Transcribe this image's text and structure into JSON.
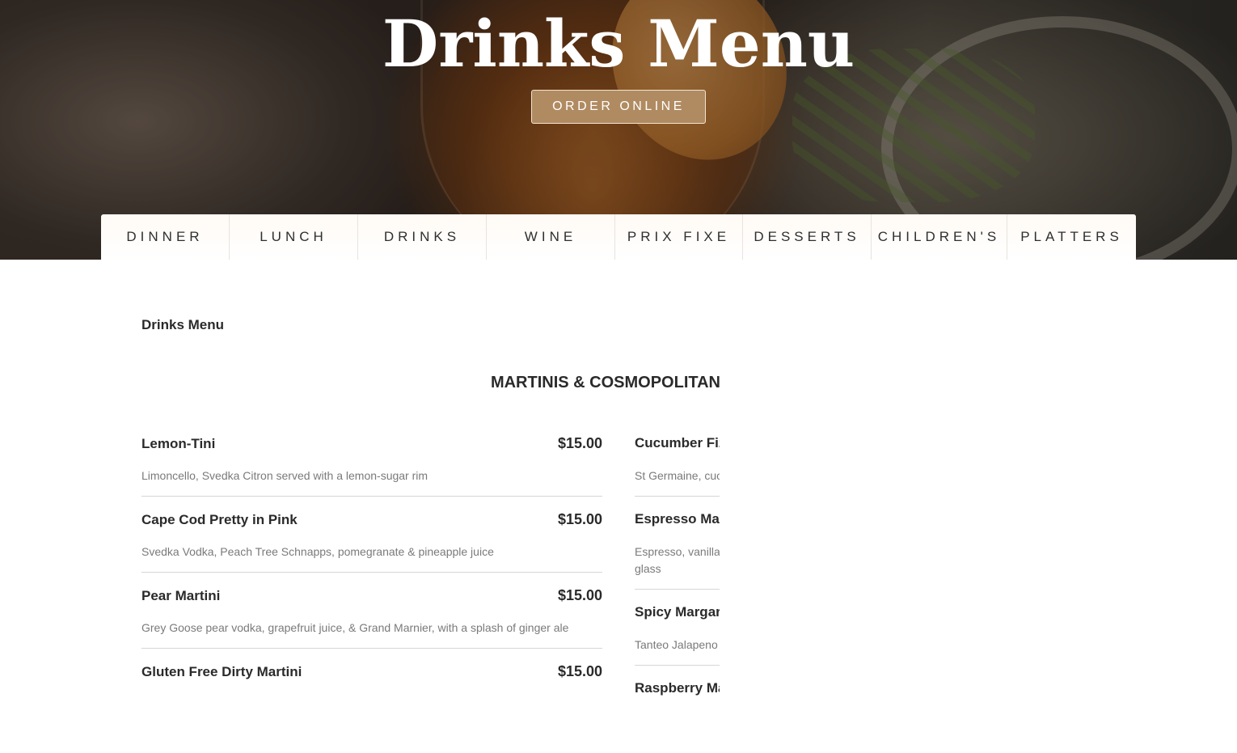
{
  "hero": {
    "title": "Drinks Menu",
    "order_button": "ORDER ONLINE"
  },
  "tabs": [
    {
      "label": "DINNER"
    },
    {
      "label": "LUNCH"
    },
    {
      "label": "DRINKS"
    },
    {
      "label": "WINE"
    },
    {
      "label": "PRIX FIXE"
    },
    {
      "label": "DESSERTS"
    },
    {
      "label": "CHILDREN'S"
    },
    {
      "label": "PLATTERS"
    }
  ],
  "menu": {
    "heading": "Drinks Menu",
    "category": "MARTINIS & COSMOPOLITAN",
    "left_items": [
      {
        "name": "Lemon-Tini",
        "price": "$15.00",
        "desc": "Limoncello, Svedka Citron served with a lemon-sugar rim"
      },
      {
        "name": "Cape Cod Pretty in Pink",
        "price": "$15.00",
        "desc": "Svedka Vodka, Peach Tree Schnapps, pomegranate & pineapple juice"
      },
      {
        "name": "Pear Martini",
        "price": "$15.00",
        "desc": "Grey Goose pear vodka, grapefruit juice, & Grand Marnier, with a splash of ginger ale"
      },
      {
        "name": "Gluten Free Dirty Martini",
        "price": "$15.00",
        "desc": ""
      }
    ],
    "right_items": [
      {
        "name": "Cucumber Fiz",
        "desc": "St Germaine, cuc",
        "desc2": ""
      },
      {
        "name": "Espresso Mar",
        "desc": "Espresso, vanilla",
        "desc2": "glass"
      },
      {
        "name": "Spicy Margarit",
        "desc": "Tanteo Jalapeno",
        "desc2": ""
      },
      {
        "name": "Raspberry Ma",
        "desc": "",
        "desc2": ""
      }
    ]
  },
  "colors": {
    "accent": "#b08b62",
    "text": "#2b2b2b",
    "muted": "#7a7a7a"
  }
}
